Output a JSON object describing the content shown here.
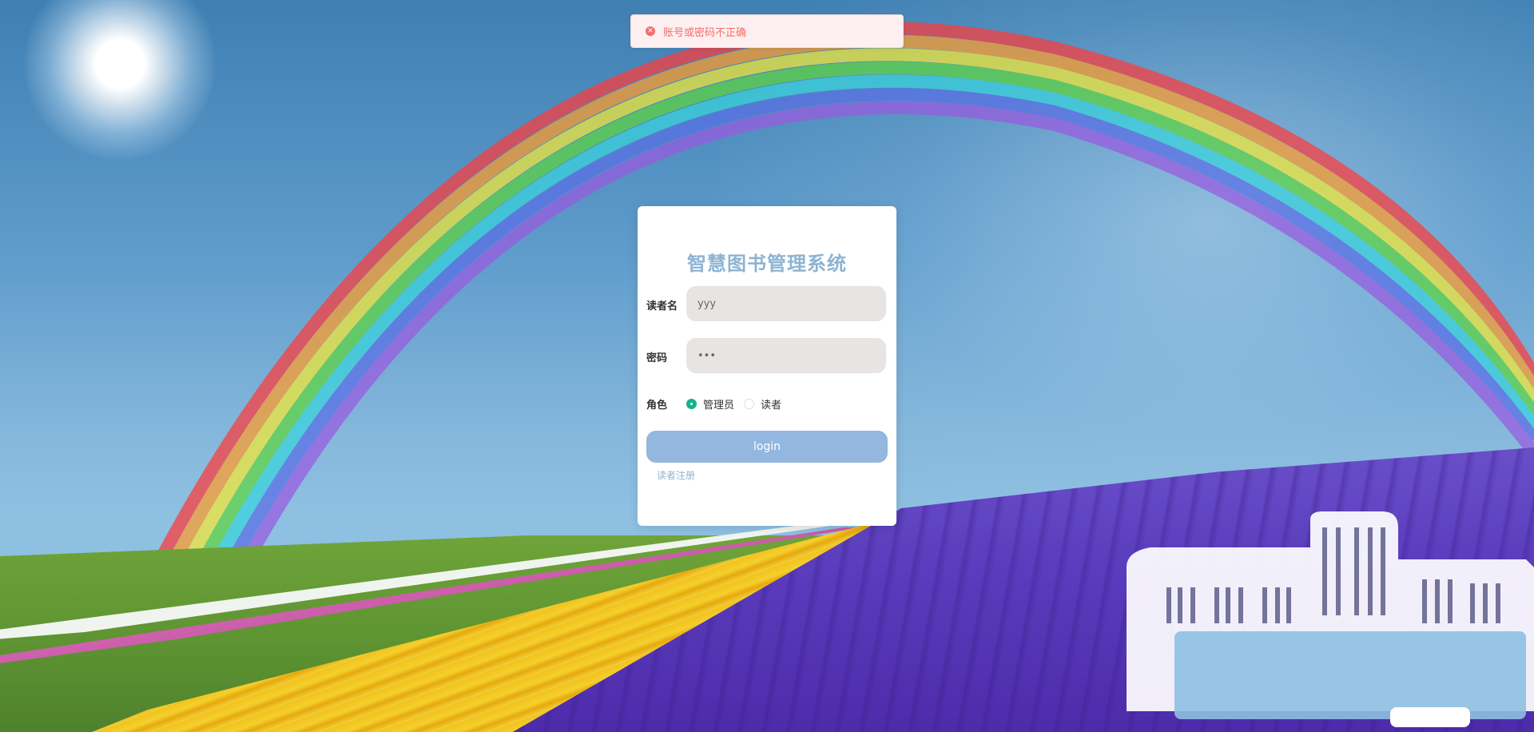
{
  "toast": {
    "message": "账号或密码不正确",
    "icon": "error-circle-icon",
    "color": "#f56c6c"
  },
  "login": {
    "title": "智慧图书管理系统",
    "username_label": "读者名",
    "username_value": "yyy",
    "password_label": "密码",
    "password_value": "•••",
    "role_label": "角色",
    "roles": [
      {
        "label": "管理员",
        "checked": true
      },
      {
        "label": "读者",
        "checked": false
      }
    ],
    "login_button": "login",
    "register_link": "读者注册"
  },
  "colors": {
    "accent": "#8db3d3",
    "button": "#93b7de",
    "radio_checked": "#13b38a",
    "input_bg": "#e8e4e4"
  }
}
